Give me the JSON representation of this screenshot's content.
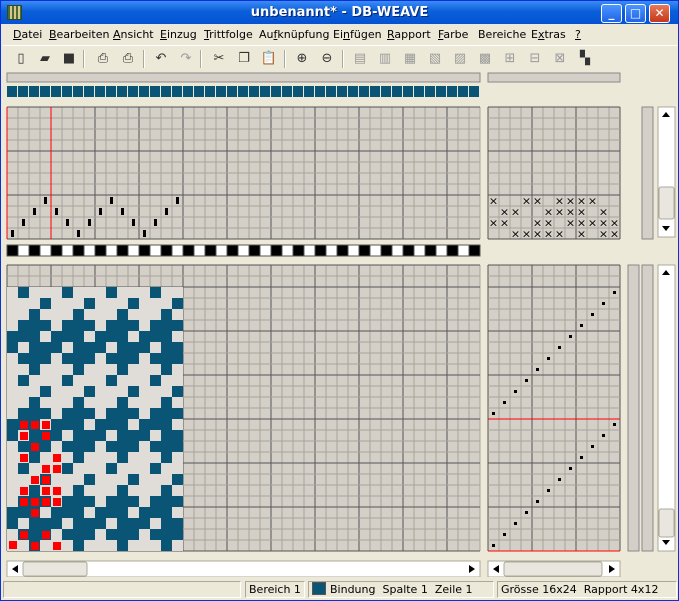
{
  "window": {
    "title": "unbenannt* - DB-WEAVE"
  },
  "menu": [
    {
      "label": "Datei",
      "accel": "D"
    },
    {
      "label": "Bearbeiten",
      "accel": "B"
    },
    {
      "label": "Ansicht",
      "accel": "A"
    },
    {
      "label": "Einzug",
      "accel": "E"
    },
    {
      "label": "Trittfolge",
      "accel": "T"
    },
    {
      "label": "Aufknüpfung",
      "accel": "f"
    },
    {
      "label": "Einfügen",
      "accel": "n"
    },
    {
      "label": "Rapport",
      "accel": "R"
    },
    {
      "label": "Farbe",
      "accel": "F"
    },
    {
      "label": "Bereiche",
      "accel": ""
    },
    {
      "label": "Extras",
      "accel": "x"
    },
    {
      "label": "?",
      "accel": "?"
    }
  ],
  "toolbar": [
    {
      "name": "new-file-icon",
      "glyph": "▯"
    },
    {
      "name": "open-folder-icon",
      "glyph": "▰"
    },
    {
      "name": "save-disk-icon",
      "glyph": "■"
    },
    {
      "name": "print-preview-icon",
      "glyph": "⎙"
    },
    {
      "name": "print-icon",
      "glyph": "⎙"
    },
    {
      "name": "undo-icon",
      "glyph": "↶"
    },
    {
      "name": "redo-icon",
      "glyph": "↷"
    },
    {
      "name": "cut-icon",
      "glyph": "✂"
    },
    {
      "name": "copy-icon",
      "glyph": "❐"
    },
    {
      "name": "paste-icon",
      "glyph": "📋"
    },
    {
      "name": "zoom-in-icon",
      "glyph": "⊕"
    },
    {
      "name": "zoom-out-icon",
      "glyph": "⊖"
    },
    {
      "name": "threading-straight-icon",
      "glyph": "▤"
    },
    {
      "name": "threading-mirror-icon",
      "glyph": "▥"
    },
    {
      "name": "threading-tool-3-icon",
      "glyph": "▦"
    },
    {
      "name": "threading-tool-4-icon",
      "glyph": "▧"
    },
    {
      "name": "threading-tool-5-icon",
      "glyph": "▨"
    },
    {
      "name": "threading-tool-6-icon",
      "glyph": "▩"
    },
    {
      "name": "threading-tool-7-icon",
      "glyph": "⊞"
    },
    {
      "name": "threading-tool-8-icon",
      "glyph": "⊟"
    },
    {
      "name": "threading-tool-9-icon",
      "glyph": "⊠"
    },
    {
      "name": "rapport-pattern-icon",
      "glyph": "▚"
    }
  ],
  "weave": {
    "threading_columns": [
      0,
      0,
      0,
      0,
      0,
      0,
      0,
      0,
      0,
      0,
      0,
      0,
      0,
      0,
      0,
      0,
      0,
      0,
      0,
      0,
      0,
      0,
      0,
      0,
      0,
      0,
      0,
      0,
      0,
      0,
      0,
      0,
      0,
      0,
      0,
      0,
      0,
      0,
      0,
      0,
      0,
      0,
      0,
      0,
      0,
      0,
      0,
      0,
      0,
      0,
      0,
      0,
      0,
      0,
      0,
      0,
      0,
      0,
      0,
      0,
      0,
      0,
      0,
      0,
      0,
      0,
      0,
      0,
      0,
      0,
      0,
      0,
      0,
      0,
      0,
      0,
      0,
      0,
      0,
      0,
      0,
      0,
      0,
      0,
      0,
      0,
      0,
      0,
      0,
      0
    ],
    "threading_rows": [
      1,
      2,
      3,
      4,
      3,
      2,
      1,
      2,
      3,
      4,
      3,
      2,
      1,
      2,
      3,
      4
    ],
    "tieup": [
      [
        1,
        0,
        0,
        1,
        1,
        0,
        1,
        1,
        1,
        1,
        0,
        0
      ],
      [
        0,
        1,
        1,
        0,
        0,
        1,
        1,
        1,
        1,
        0,
        1,
        0
      ],
      [
        1,
        1,
        0,
        0,
        1,
        1,
        0,
        1,
        1,
        1,
        1,
        1
      ],
      [
        0,
        0,
        1,
        1,
        1,
        1,
        1,
        0,
        1,
        0,
        1,
        1
      ]
    ],
    "treadling": [
      11,
      10,
      9,
      8,
      7,
      6,
      5,
      4,
      3,
      2,
      1,
      0,
      11,
      10,
      9,
      8,
      7,
      6,
      5,
      4,
      3,
      2,
      1,
      0
    ],
    "color_row_pattern": [
      1,
      1,
      0,
      1,
      0,
      1,
      1,
      0,
      0,
      1,
      1,
      0,
      1,
      0,
      1,
      1,
      0,
      0,
      1,
      1,
      0,
      1,
      0,
      1,
      1,
      0,
      0,
      1,
      1,
      0,
      1,
      0,
      1,
      1,
      0,
      0,
      1,
      1,
      0,
      1,
      0,
      1,
      1,
      0,
      0,
      1,
      1,
      0,
      1,
      0,
      1,
      1,
      0,
      0,
      1,
      1,
      0,
      1,
      0,
      1,
      1,
      0,
      0,
      1,
      1,
      0,
      1,
      0,
      1,
      1,
      0,
      0,
      1,
      1,
      0,
      1,
      0,
      1,
      1,
      0,
      0,
      1,
      1,
      0,
      1,
      0,
      1,
      1,
      0,
      0
    ],
    "colors": {
      "weave": "#0a5475",
      "light": "#e0dcd8",
      "grid_cell": "#d4d0c8",
      "grid_line": "#a8a49c",
      "mark": "#000000",
      "red": "#ff0000"
    },
    "red_marks": [
      [
        0,
        0
      ],
      [
        0,
        1
      ],
      [
        0,
        2
      ],
      [
        1,
        0
      ],
      [
        1,
        2
      ],
      [
        2,
        1
      ],
      [
        3,
        0
      ],
      [
        3,
        3
      ],
      [
        4,
        2
      ],
      [
        4,
        3
      ],
      [
        5,
        1
      ],
      [
        5,
        2
      ],
      [
        6,
        0
      ],
      [
        6,
        2
      ],
      [
        6,
        3
      ],
      [
        7,
        0
      ],
      [
        7,
        1
      ],
      [
        7,
        2
      ],
      [
        7,
        3
      ],
      [
        8,
        1
      ],
      [
        10,
        0
      ],
      [
        10,
        2
      ],
      [
        11,
        1
      ],
      [
        11,
        3
      ]
    ]
  },
  "status": {
    "area": "Bereich 1",
    "binding": "Bindung",
    "column": "Spalte 1",
    "row": "Zeile 1",
    "size": "Grösse 16x24",
    "rapport": "Rapport 4x12"
  }
}
